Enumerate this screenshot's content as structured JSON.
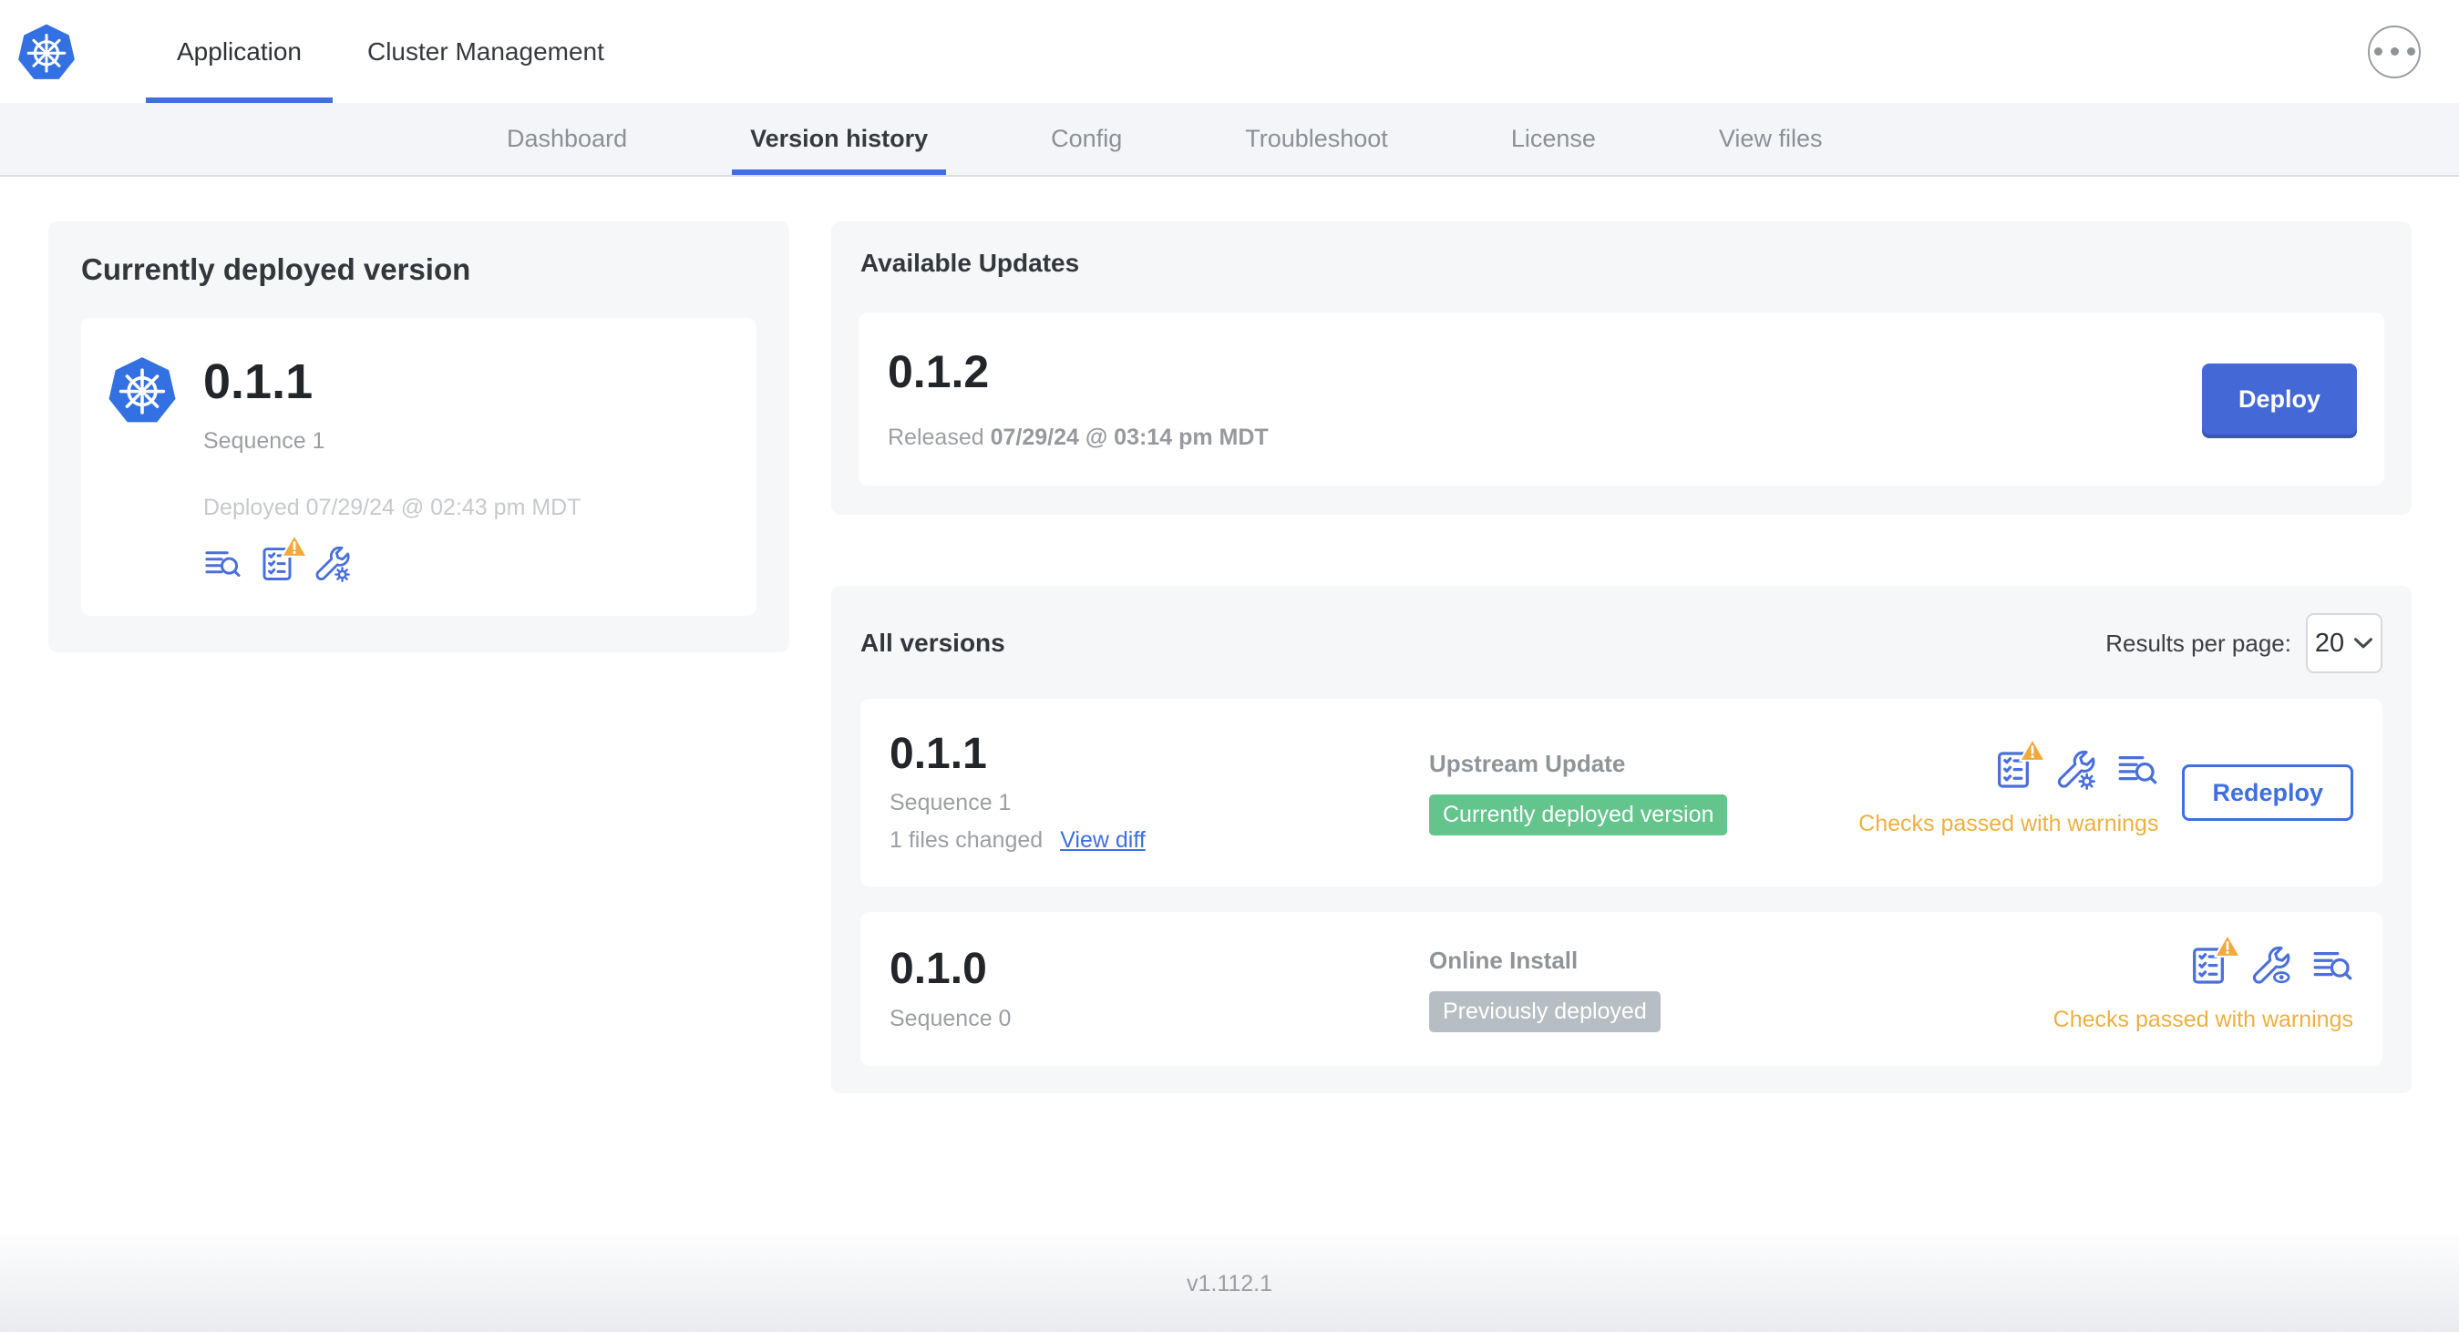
{
  "header": {
    "tabs": [
      {
        "label": "Application",
        "active": true
      },
      {
        "label": "Cluster Management",
        "active": false
      }
    ]
  },
  "subnav": {
    "tabs": [
      {
        "label": "Dashboard",
        "active": false
      },
      {
        "label": "Version history",
        "active": true
      },
      {
        "label": "Config",
        "active": false
      },
      {
        "label": "Troubleshoot",
        "active": false
      },
      {
        "label": "License",
        "active": false
      },
      {
        "label": "View files",
        "active": false
      }
    ]
  },
  "current_version_card": {
    "title": "Currently deployed version",
    "version": "0.1.1",
    "sequence": "Sequence 1",
    "deployed": "Deployed 07/29/24 @ 02:43 pm MDT",
    "icons": [
      "logs-icon",
      "preflight-checks-warning-icon",
      "config-wrench-gear-icon"
    ]
  },
  "available_updates": {
    "title": "Available Updates",
    "version": "0.1.2",
    "released_prefix": "Released",
    "released_date": "07/29/24 @ 03:14 pm MDT",
    "deploy_label": "Deploy"
  },
  "all_versions": {
    "title": "All versions",
    "results_per_page_label": "Results per page:",
    "results_per_page_value": "20",
    "rows": [
      {
        "version": "0.1.1",
        "sequence": "Sequence 1",
        "files_changed": "1 files changed",
        "view_diff_label": "View diff",
        "source": "Upstream Update",
        "badge": "Currently deployed version",
        "badge_color": "green",
        "status": "Checks passed with warnings",
        "action_label": "Redeploy",
        "icons": [
          "preflight-checks-warning-icon",
          "config-wrench-gear-icon",
          "logs-icon"
        ]
      },
      {
        "version": "0.1.0",
        "sequence": "Sequence 0",
        "source": "Online Install",
        "badge": "Previously deployed",
        "badge_color": "gray",
        "status": "Checks passed with warnings",
        "icons": [
          "preflight-checks-warning-icon",
          "config-wrench-eye-icon",
          "logs-icon"
        ]
      }
    ]
  },
  "footer": {
    "app_version": "v1.112.1"
  },
  "colors": {
    "primary_blue": "#3f6fe0",
    "button_blue": "#4469d6",
    "icon_blue": "#4a6fdc",
    "badge_green": "#63c58c",
    "badge_gray": "#b7bec3",
    "warning_orange": "#eeb041",
    "triangle_orange": "#f2a93b",
    "kubernetes_logo_blue": "#3371e3"
  }
}
